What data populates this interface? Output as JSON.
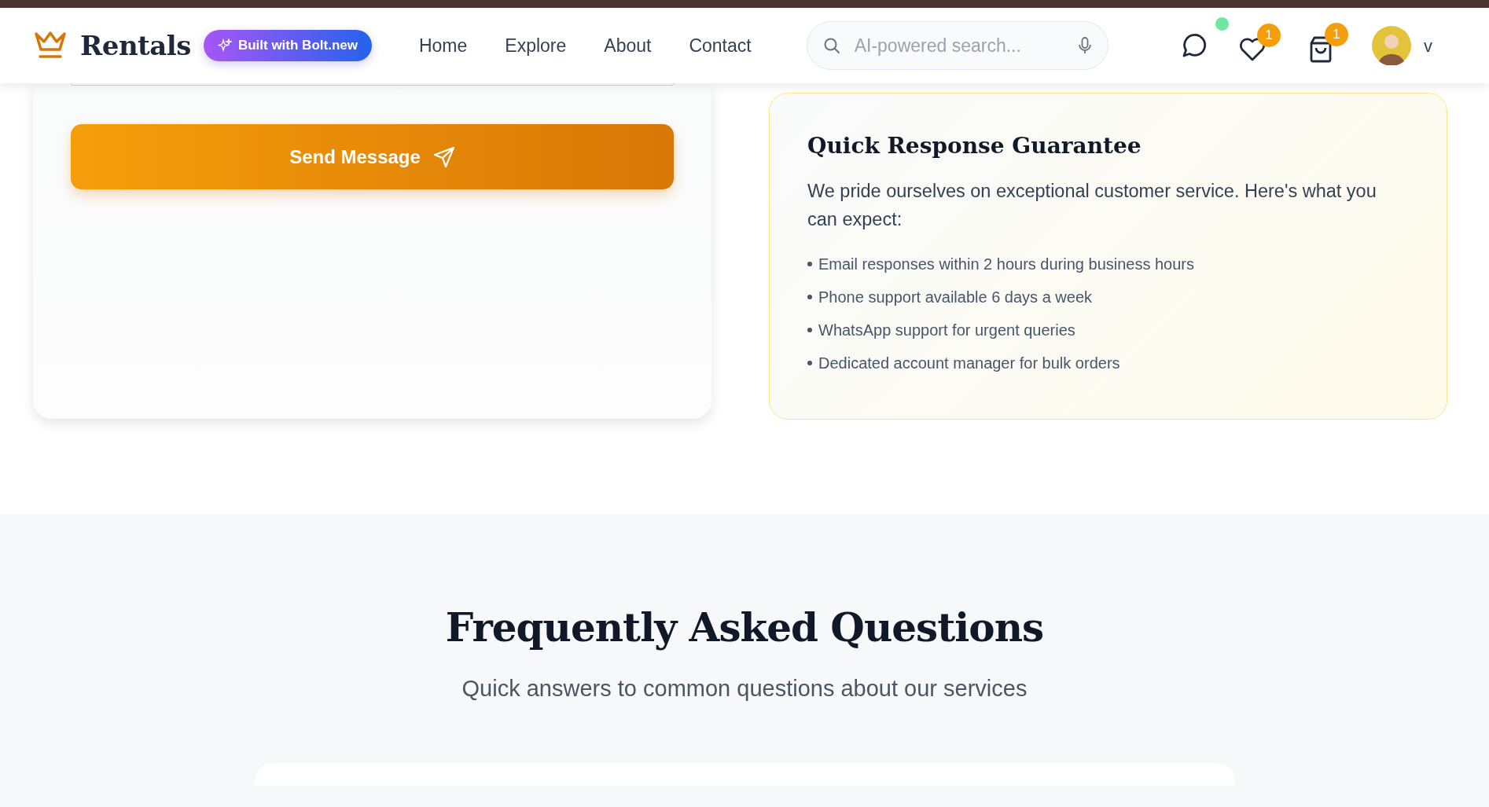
{
  "brand": {
    "name": "Rentals"
  },
  "badge": "Built with Bolt.new",
  "nav": [
    {
      "label": "Home"
    },
    {
      "label": "Explore"
    },
    {
      "label": "About"
    },
    {
      "label": "Contact"
    }
  ],
  "search": {
    "placeholder": "AI-powered search..."
  },
  "messages": {
    "online": true
  },
  "wishlist": {
    "count": "1"
  },
  "cart": {
    "count": "1"
  },
  "user": {
    "initial": "v"
  },
  "contact_form": {
    "button": "Send Message"
  },
  "guarantee": {
    "title": "Quick Response Guarantee",
    "text": "We pride ourselves on exceptional customer service. Here's what you can expect:",
    "items": [
      "Email responses within 2 hours during business hours",
      "Phone support available 6 days a week",
      "WhatsApp support for urgent queries",
      "Dedicated account manager for bulk orders"
    ]
  },
  "faq": {
    "title": "Frequently Asked Questions",
    "subtitle": "Quick answers to common questions about our services"
  }
}
